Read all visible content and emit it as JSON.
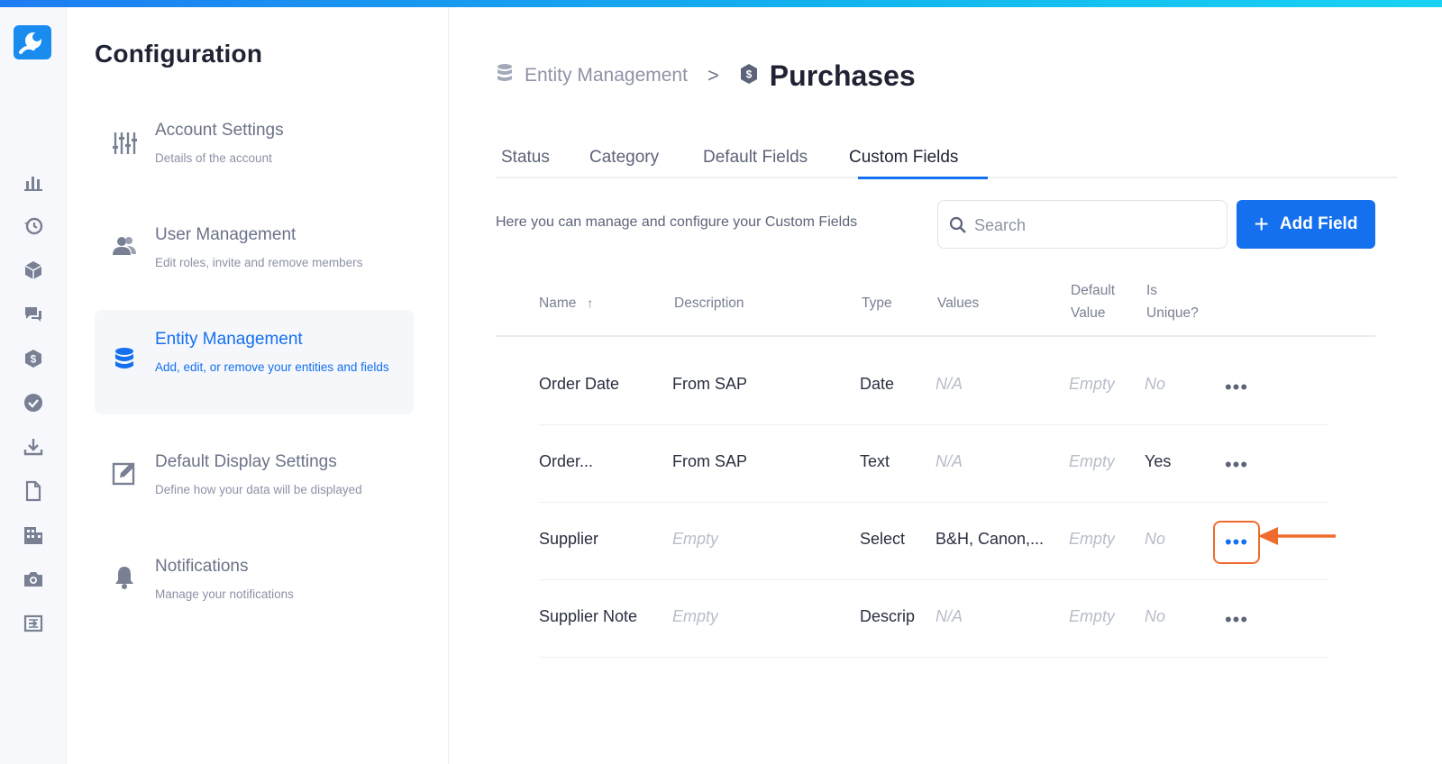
{
  "config": {
    "title": "Configuration",
    "items": [
      {
        "title": "Account Settings",
        "desc": "Details of the account",
        "icon": "sliders-icon"
      },
      {
        "title": "User Management",
        "desc": "Edit roles, invite and remove members",
        "icon": "users-icon"
      },
      {
        "title": "Entity Management",
        "desc": "Add, edit, or remove your entities and fields",
        "icon": "database-icon"
      },
      {
        "title": "Default Display Settings",
        "desc": "Define how your data will be displayed",
        "icon": "edit-square-icon"
      },
      {
        "title": "Notifications",
        "desc": "Manage your notifications",
        "icon": "bell-icon"
      }
    ]
  },
  "breadcrumb": {
    "parent": "Entity Management",
    "separator": ">",
    "current": "Purchases"
  },
  "tabs": [
    "Status",
    "Category",
    "Default Fields",
    "Custom Fields"
  ],
  "active_tab": "Custom Fields",
  "intro_text": "Here you can manage and configure your Custom Fields",
  "search": {
    "placeholder": "Search",
    "value": ""
  },
  "add_button": {
    "label": "Add Field",
    "plus": "+"
  },
  "table": {
    "headers": {
      "name": "Name",
      "description": "Description",
      "type": "Type",
      "values": "Values",
      "default_value_1": "Default",
      "default_value_2": "Value",
      "is_unique_1": "Is",
      "is_unique_2": "Unique?"
    },
    "sort_indicator": "↑",
    "more_label": "•••",
    "rows": [
      {
        "name": "Order Date",
        "description": "From SAP",
        "type": "Date",
        "values": "N/A",
        "default_value": "Empty",
        "is_unique": "No"
      },
      {
        "name": "Order...",
        "description": "From SAP",
        "type": "Text",
        "values": "N/A",
        "default_value": "Empty",
        "is_unique": "Yes"
      },
      {
        "name": "Supplier",
        "description": "Empty",
        "type": "Select",
        "values": "B&H, Canon,...",
        "default_value": "Empty",
        "is_unique": "No"
      },
      {
        "name": "Supplier Note",
        "description": "Empty",
        "type": "Descrip",
        "values": "N/A",
        "default_value": "Empty",
        "is_unique": "No"
      }
    ]
  },
  "colors": {
    "accent": "#1570ef",
    "highlight": "#f06b2e",
    "muted_text": "#b8bdca"
  }
}
